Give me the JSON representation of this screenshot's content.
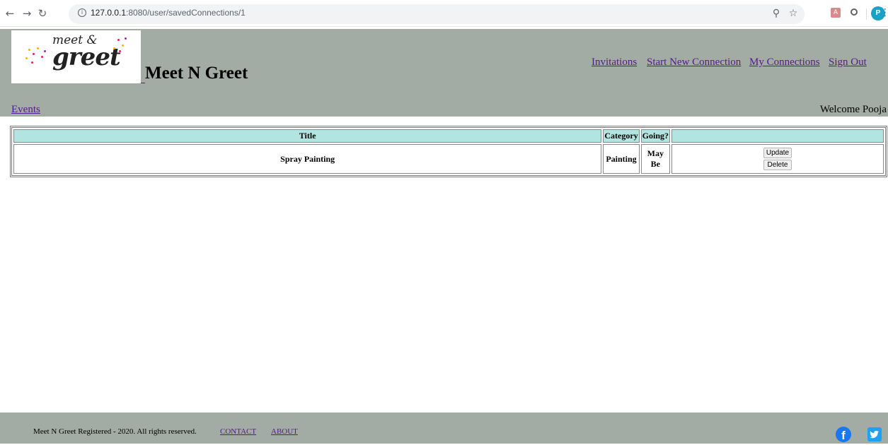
{
  "browser": {
    "top_cut_text": "r r",
    "url_host": "127.0.0.1",
    "url_port_path": ":8080/user/savedConnections/1",
    "profile_initial": "P",
    "pdf_label": "A"
  },
  "header": {
    "logo_meet": "meet &",
    "logo_greet": "greet",
    "site_title": "Meet N Greet",
    "nav": {
      "invitations": "Invitations",
      "start_new": "Start New Connection",
      "my_connections": "My Connections",
      "sign_out": "Sign Out"
    },
    "events": "Events",
    "welcome": "Welcome Pooja"
  },
  "table": {
    "headers": [
      "Title",
      "Category",
      "Going?",
      ""
    ],
    "rows": [
      {
        "title": "Spray Painting",
        "category": "Painting",
        "going": "May Be",
        "update_label": "Update",
        "delete_label": "Delete"
      }
    ]
  },
  "footer": {
    "text": "Meet N Greet Registered - 2020. All rights reserved.",
    "contact": "CONTACT",
    "about": "ABOUT",
    "fb_glyph": "f"
  },
  "colors": {
    "header_bg": "#a2aba4",
    "table_header_bg": "#b2e5e1",
    "link": "#551a8b"
  }
}
